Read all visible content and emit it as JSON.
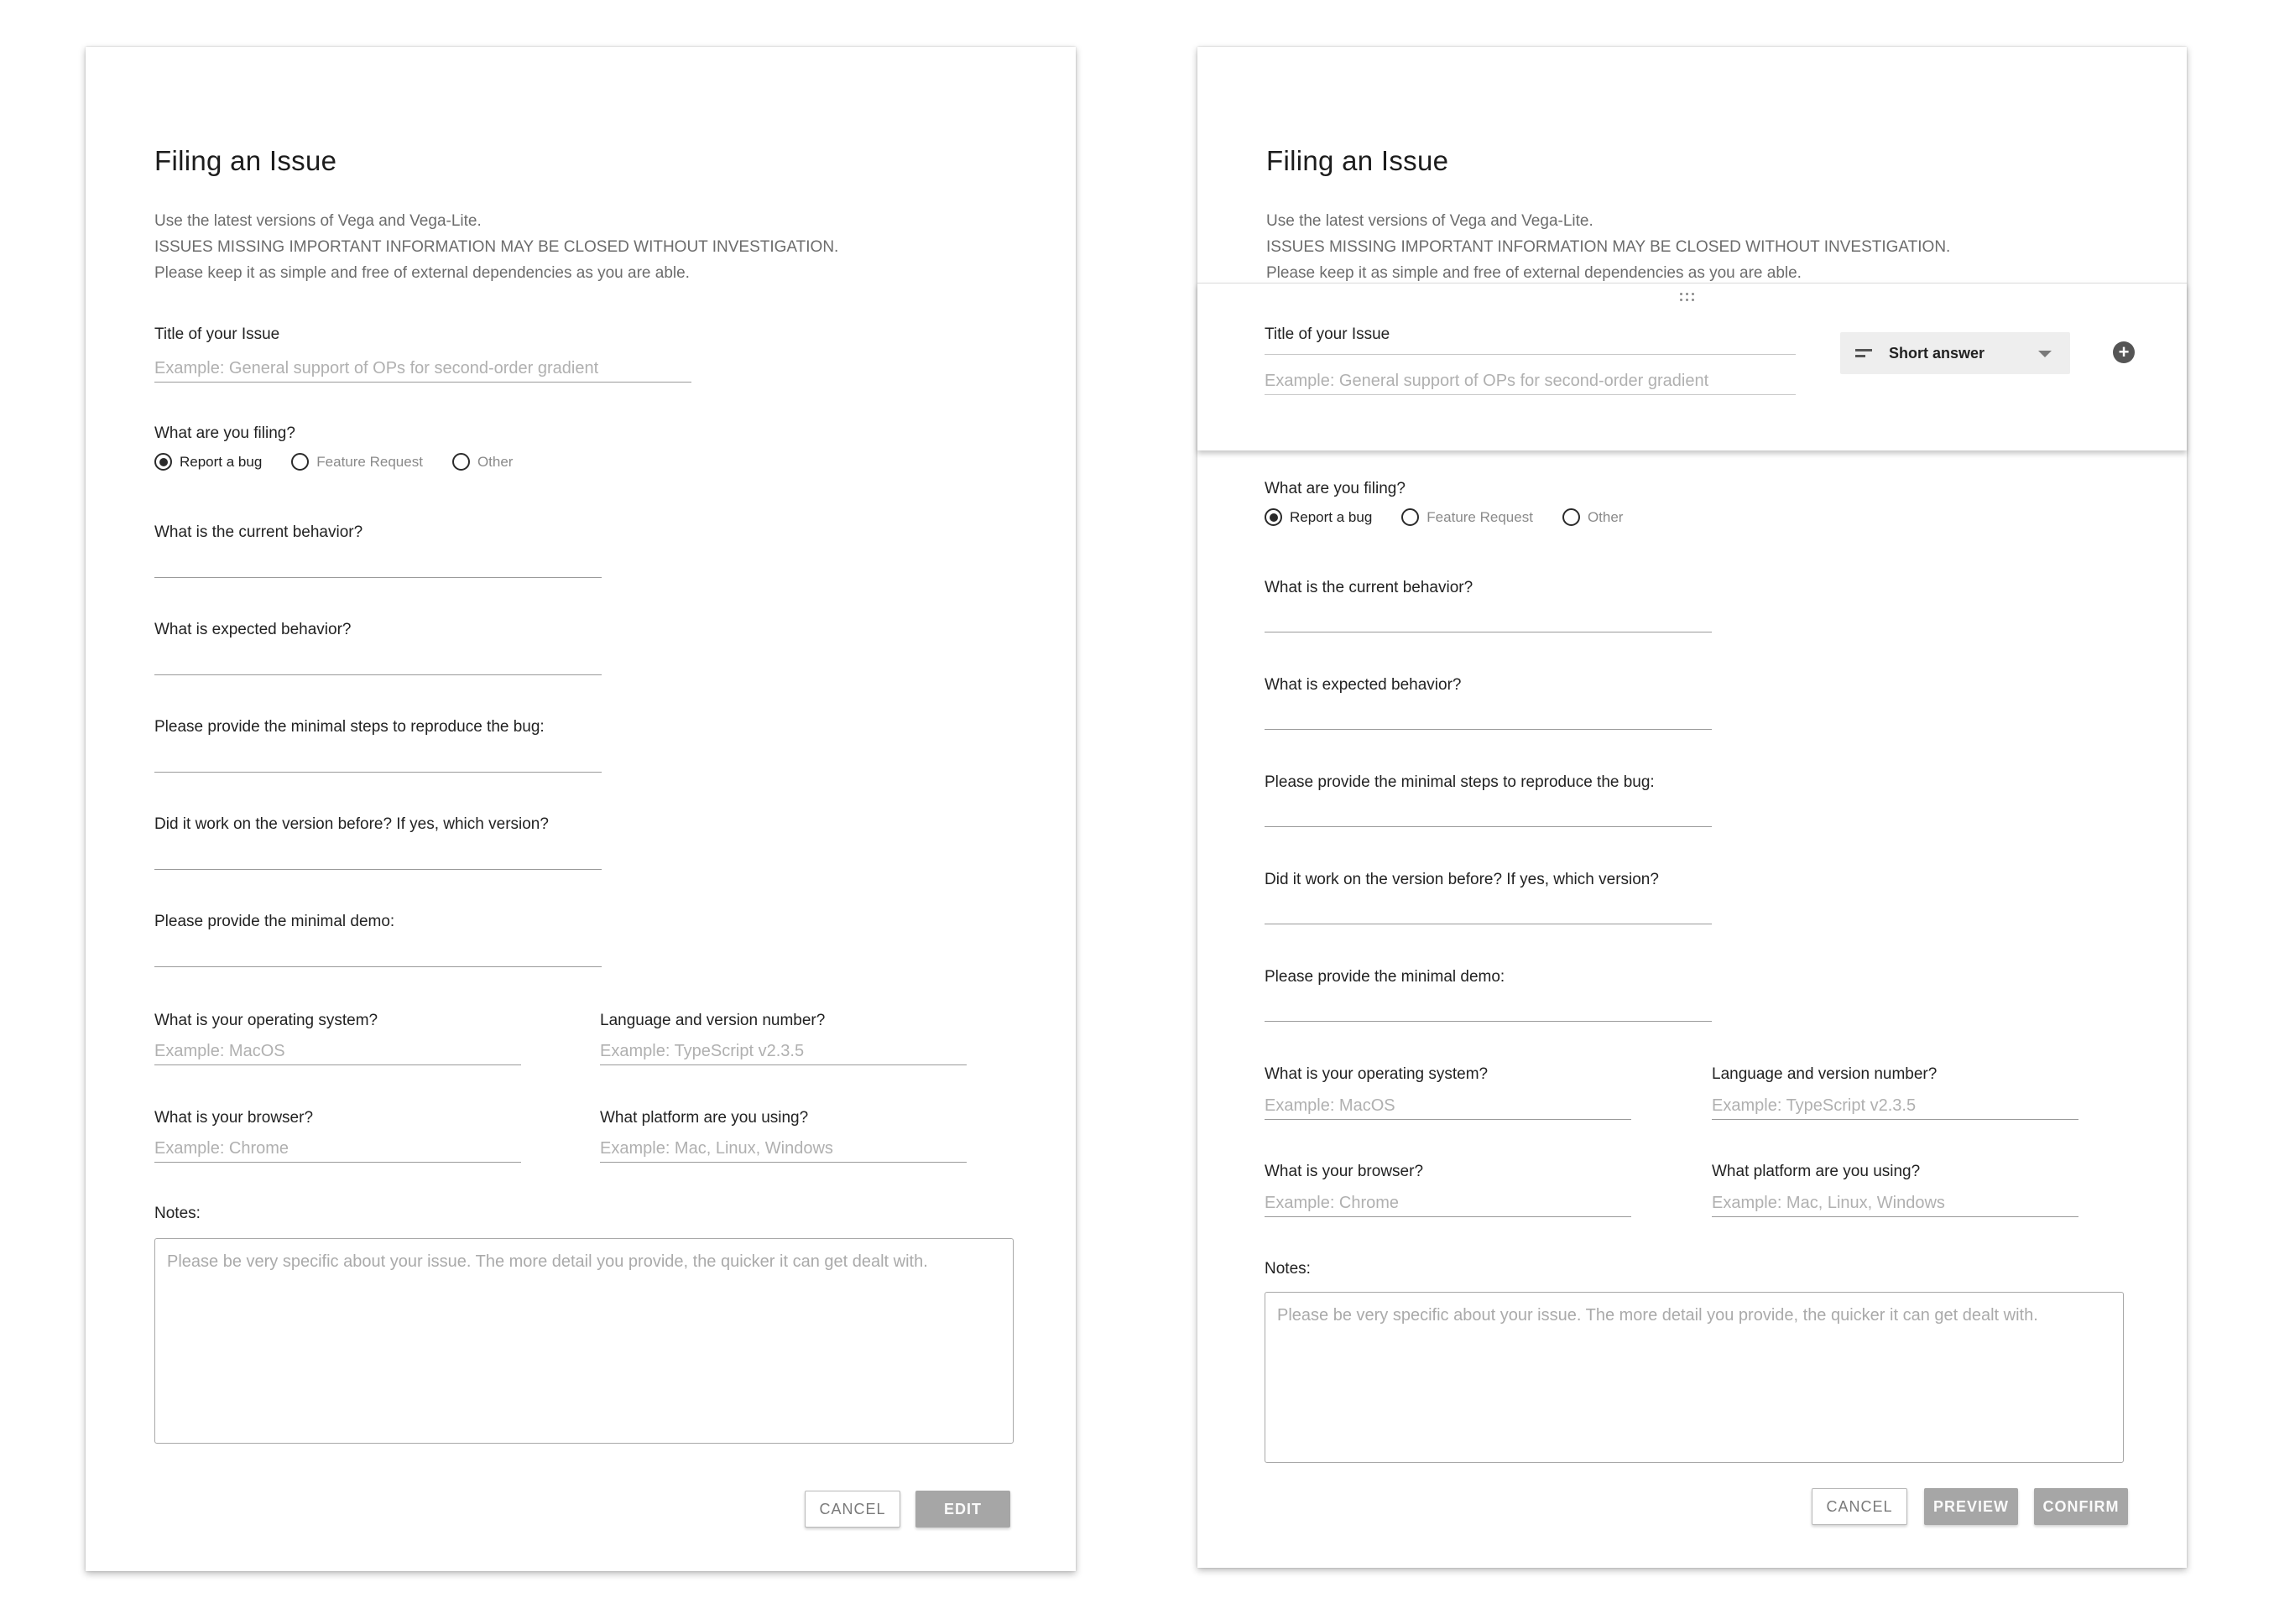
{
  "form": {
    "title": "Filing an Issue",
    "intro": [
      "Use the latest versions of Vega and Vega-Lite.",
      "ISSUES MISSING IMPORTANT INFORMATION MAY BE CLOSED WITHOUT INVESTIGATION.",
      "Please keep it as simple and free of external dependencies as you are able."
    ],
    "issue_title": {
      "label": "Title of your Issue",
      "placeholder": "Example: General support of OPs for second-order gradient"
    },
    "filing": {
      "label": "What are you filing?",
      "options": [
        "Report a bug",
        "Feature Request",
        "Other"
      ],
      "selected": "Report a bug"
    },
    "questions": [
      "What is the current behavior?",
      "What is expected behavior?",
      "Please provide the minimal steps to reproduce the bug:",
      "Did it work on the version before? If yes, which version?",
      "Please provide the minimal demo:"
    ],
    "os": {
      "label": "What is your operating system?",
      "placeholder": "Example: MacOS"
    },
    "language": {
      "label": "Language and version number?",
      "placeholder": "Example: TypeScript v2.3.5"
    },
    "browser": {
      "label": "What is your browser?",
      "placeholder": "Example: Chrome"
    },
    "platform": {
      "label": "What platform are you using?",
      "placeholder": "Example: Mac, Linux, Windows"
    },
    "notes": {
      "label": "Notes:",
      "placeholder": "Please be very specific about your issue. The more detail you provide, the quicker it can get dealt with."
    }
  },
  "left_buttons": {
    "cancel": "CANCEL",
    "edit": "EDIT"
  },
  "right_editor": {
    "question_type": "Short answer",
    "type_icon": "short-answer-icon",
    "add_icon": "add-circle-icon",
    "drag_icon": "drag-handle-icon"
  },
  "right_buttons": {
    "cancel": "CANCEL",
    "preview": "PREVIEW",
    "confirm": "CONFIRM"
  }
}
